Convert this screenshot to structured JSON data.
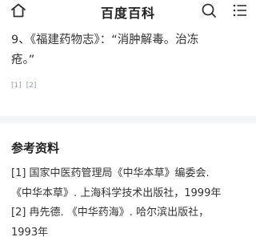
{
  "header": {
    "title": "百度百科",
    "home_icon": "home-icon",
    "search_icon": "search-icon",
    "menu_icon": "menu-icon"
  },
  "entry": {
    "line1": "9、《福建药物志》：“消肿解毒。治冻",
    "line2": "疮。”"
  },
  "inline_refs": [
    "[1]",
    "[2]"
  ],
  "references": {
    "title": "参考资料",
    "items": [
      {
        "line1": "[1]  国家中医药管理局《中华本草》编委会.",
        "line2": "《中华本草》. 上海科学技术出版社，1999年"
      },
      {
        "line1": "[2]  冉先德. 《中华药海》. 哈尔滨出版社，",
        "line2": "1993年"
      }
    ]
  },
  "colors": {
    "text": "#333333",
    "muted": "#9aa0a6",
    "separator": "#f4f5f7"
  }
}
